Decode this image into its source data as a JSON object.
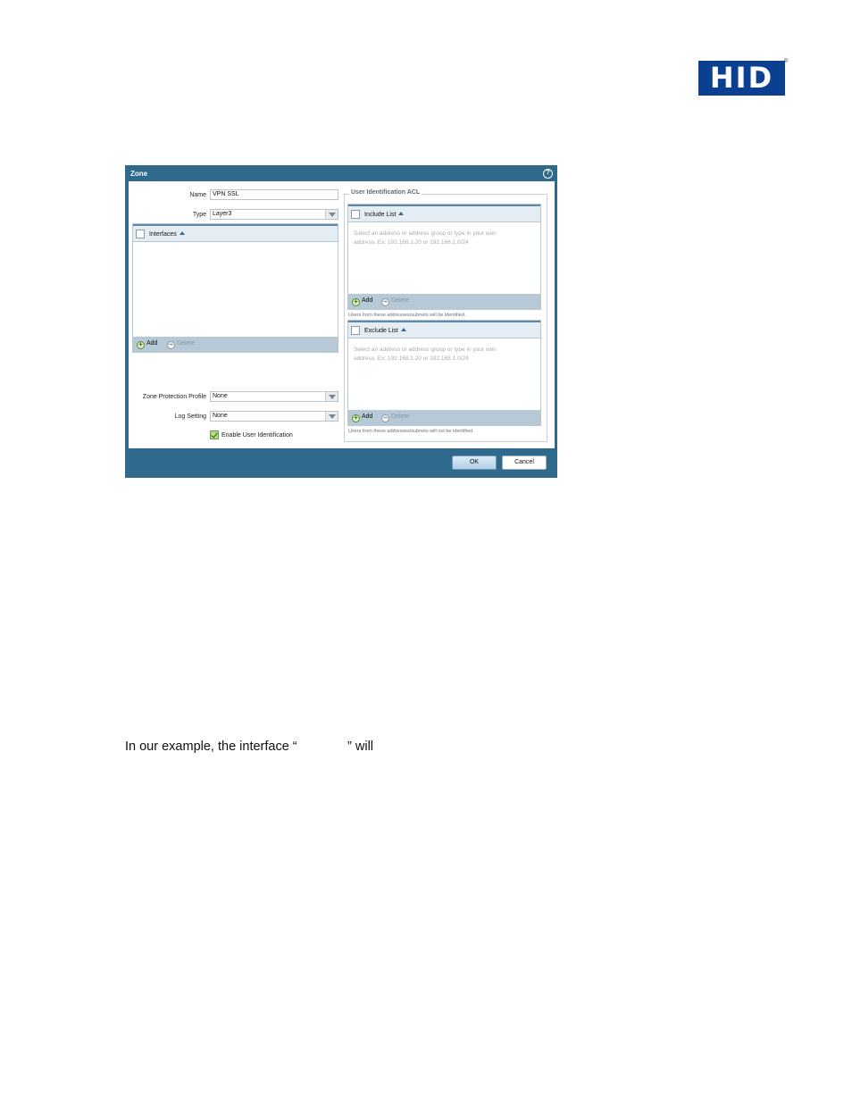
{
  "logo": {
    "text": "HID",
    "registered": "®"
  },
  "dialog": {
    "title": "Zone",
    "help_icon": "help-circle-icon",
    "name_label": "Name",
    "name_value": "VPN SSL",
    "type_label": "Type",
    "type_value": "Layer3",
    "interfaces": {
      "header": "Interfaces",
      "add_label": "Add",
      "delete_label": "Delete"
    },
    "zone_protection_label": "Zone Protection Profile",
    "zone_protection_value": "None",
    "log_setting_label": "Log Setting",
    "log_setting_value": "None",
    "enable_user_id_label": "Enable User Identification",
    "enable_user_id_checked": true,
    "acl": {
      "legend": "User Identification ACL",
      "include": {
        "header": "Include List",
        "placeholder_line1": "Select an address or address group or type in your own",
        "placeholder_line2": "address. Ex: 192.168.1.20 or 192.168.1.0/24",
        "add_label": "Add",
        "delete_label": "Delete",
        "note": "Users from these addresses/subnets will be identified."
      },
      "exclude": {
        "header": "Exclude List",
        "placeholder_line1": "Select an address or address group or type in your own",
        "placeholder_line2": "address. Ex: 192.168.1.20 or 192.168.1.0/24",
        "add_label": "Add",
        "delete_label": "Delete",
        "note": "Users from these addresses/subnets will not be identified."
      }
    },
    "ok_label": "OK",
    "cancel_label": "Cancel"
  },
  "body_text": "In our example, the interface “              ” will",
  "colors": {
    "dialog_frame": "#2f6a8d",
    "logo_blue": "#0b3f8f"
  }
}
